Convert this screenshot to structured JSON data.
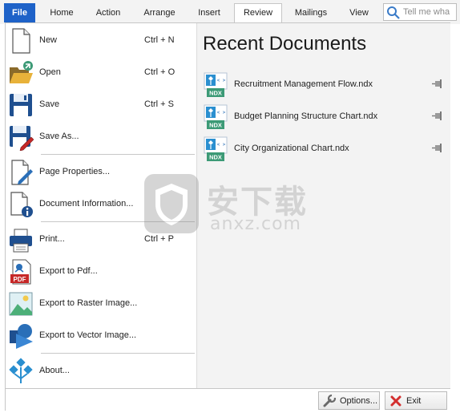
{
  "ribbon": {
    "tabs": [
      {
        "label": "File"
      },
      {
        "label": "Home"
      },
      {
        "label": "Action"
      },
      {
        "label": "Arrange"
      },
      {
        "label": "Insert"
      },
      {
        "label": "Review"
      },
      {
        "label": "Mailings"
      },
      {
        "label": "View"
      }
    ],
    "active_tab": "Review",
    "search_placeholder": "Tell me wha"
  },
  "menu": {
    "items": [
      {
        "label": "New",
        "shortcut": "Ctrl + N",
        "icon": "new-document-icon"
      },
      {
        "label": "Open",
        "shortcut": "Ctrl + O",
        "icon": "open-folder-icon"
      },
      {
        "label": "Save",
        "shortcut": "Ctrl + S",
        "icon": "save-floppy-icon"
      },
      {
        "label": "Save As...",
        "shortcut": "",
        "icon": "save-as-icon"
      },
      {
        "label": "Page Properties...",
        "shortcut": "",
        "icon": "page-properties-icon"
      },
      {
        "label": "Document Information...",
        "shortcut": "",
        "icon": "document-information-icon"
      },
      {
        "label": "Print...",
        "shortcut": "Ctrl + P",
        "icon": "printer-icon"
      },
      {
        "label": "Export to Pdf...",
        "shortcut": "",
        "icon": "pdf-icon"
      },
      {
        "label": "Export to Raster Image...",
        "shortcut": "",
        "icon": "raster-image-icon"
      },
      {
        "label": "Export to Vector Image...",
        "shortcut": "",
        "icon": "vector-image-icon"
      },
      {
        "label": "About...",
        "shortcut": "",
        "icon": "about-logo-icon"
      }
    ]
  },
  "recent": {
    "title": "Recent Documents",
    "badge": "NDX",
    "documents": [
      {
        "name": "Recruitment Management Flow.ndx"
      },
      {
        "name": "Budget Planning Structure Chart.ndx"
      },
      {
        "name": "City Organizational Chart.ndx"
      }
    ]
  },
  "footer": {
    "options_label": "Options...",
    "exit_label": "Exit"
  },
  "watermark": {
    "cn": "安下载",
    "en": "anxz.com"
  },
  "colors": {
    "file_tab": "#1e62c8",
    "accent_blue": "#2a6fb8",
    "ndx_badge": "#3c9a76",
    "pdf_red": "#c62828",
    "exit_red": "#d32f2f"
  }
}
